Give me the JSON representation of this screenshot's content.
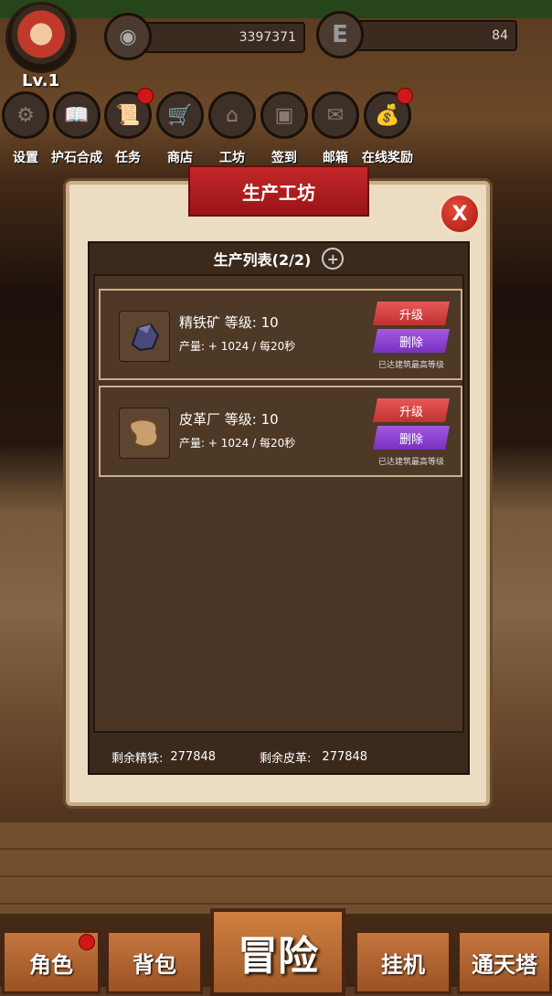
{
  "player": {
    "level": "Lv.1"
  },
  "currency": {
    "coins": "3397371",
    "energy_icon": "E",
    "energy": "84"
  },
  "menu": [
    {
      "label": "设置",
      "icon": "gear-icon",
      "glyph": "⚙",
      "badge": false
    },
    {
      "label": "护石合成",
      "icon": "book-icon",
      "glyph": "📖",
      "badge": false
    },
    {
      "label": "任务",
      "icon": "scroll-icon",
      "glyph": "📜",
      "badge": true
    },
    {
      "label": "商店",
      "icon": "cart-icon",
      "glyph": "🛒",
      "badge": false
    },
    {
      "label": "工坊",
      "icon": "house-icon",
      "glyph": "⌂",
      "badge": false
    },
    {
      "label": "签到",
      "icon": "chest-icon",
      "glyph": "▣",
      "badge": false
    },
    {
      "label": "邮箱",
      "icon": "mail-icon",
      "glyph": "✉",
      "badge": false
    },
    {
      "label": "在线奖励",
      "icon": "bag-icon",
      "glyph": "💰",
      "badge": true
    }
  ],
  "dialog": {
    "title": "生产工坊",
    "close": "X",
    "list_header": "生产列表(2/2)",
    "add_glyph": "+",
    "items": [
      {
        "name": "精铁矿 等级: 10",
        "production": "产量: + 1024 / 每20秒",
        "upgrade": "升级",
        "delete": "删除",
        "status": "已达建筑最高等级",
        "icon": "iron-ore-icon"
      },
      {
        "name": "皮革厂 等级: 10",
        "production": "产量: + 1024 / 每20秒",
        "upgrade": "升级",
        "delete": "删除",
        "status": "已达建筑最高等级",
        "icon": "leather-icon"
      }
    ],
    "footer": {
      "iron_label": "剩余精铁:",
      "iron_value": "277848",
      "leather_label": "剩余皮革:",
      "leather_value": "277848"
    }
  },
  "bottom_nav": {
    "character": "角色",
    "bag": "背包",
    "adventure": "冒险",
    "idle": "挂机",
    "tower": "通天塔"
  },
  "colors": {
    "title_red": "#b41e20",
    "upgrade_red": "#d84444",
    "delete_purple": "#8c40d0",
    "badge_red": "#d01818"
  }
}
